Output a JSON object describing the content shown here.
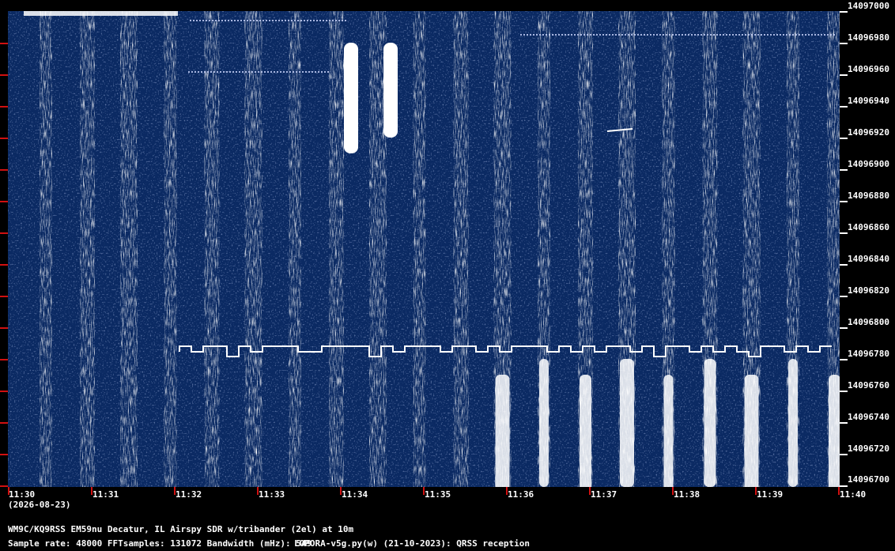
{
  "date_label": "(2026-08-23)",
  "y_axis_labels": [
    "14097000",
    "14096980",
    "14096960",
    "14096940",
    "14096920",
    "14096900",
    "14096880",
    "14096860",
    "14096840",
    "14096820",
    "14096800",
    "14096780",
    "14096760",
    "14096740",
    "14096720",
    "14096700"
  ],
  "x_axis_labels": [
    "11:30",
    "11:31",
    "11:32",
    "11:33",
    "11:34",
    "11:35",
    "11:36",
    "11:37",
    "11:38",
    "11:39",
    "11:40"
  ],
  "station_line": "WM9C/KQ9RSS EM59nu Decatur, IL  Airspy SDR w/tribander (2el) at 10m",
  "params_line": "Sample rate: 48000    FFTsamples: 131072    Bandwidth (mHz): 549",
  "software_line": "LOPORA-v5g.py(w) (21-10-2023): QRSS reception",
  "colors": {
    "background": "#0b2a63",
    "signal": "#ffffff",
    "tick_marks": "#d01010"
  }
}
